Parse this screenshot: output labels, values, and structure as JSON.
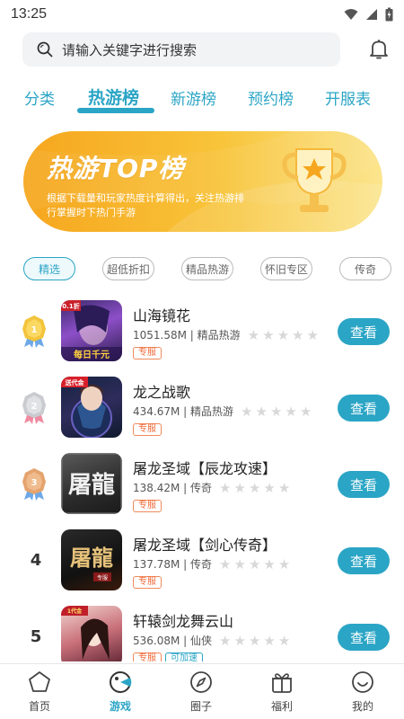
{
  "status": {
    "time": "13:25"
  },
  "search": {
    "placeholder": "请输入关键字进行搜索"
  },
  "tabs": [
    {
      "label": "分类",
      "active": false
    },
    {
      "label": "热游榜",
      "active": true
    },
    {
      "label": "新游榜",
      "active": false
    },
    {
      "label": "预约榜",
      "active": false
    },
    {
      "label": "开服表",
      "active": false
    }
  ],
  "banner": {
    "title": "热游TOP榜",
    "description": "根据下载量和玩家热度计算得出，关注热游排行掌握时下热门手游"
  },
  "filters": [
    {
      "label": "精选",
      "active": true
    },
    {
      "label": "超低折扣",
      "active": false
    },
    {
      "label": "精品热游",
      "active": false
    },
    {
      "label": "怀旧专区",
      "active": false
    },
    {
      "label": "传奇",
      "active": false
    }
  ],
  "games": [
    {
      "rank": "1",
      "name": "山海镜花",
      "size": "1051.58M",
      "category": "精品热游",
      "tags": [
        "专服"
      ],
      "rating": 0,
      "action": "查看"
    },
    {
      "rank": "2",
      "name": "龙之战歌",
      "size": "434.67M",
      "category": "精品热游",
      "tags": [
        "专服"
      ],
      "rating": 0,
      "action": "查看"
    },
    {
      "rank": "3",
      "name": "屠龙圣域【辰龙攻速】",
      "size": "138.42M",
      "category": "传奇",
      "tags": [
        "专服"
      ],
      "rating": 0,
      "action": "查看"
    },
    {
      "rank": "4",
      "name": "屠龙圣域【剑心传奇】",
      "size": "137.78M",
      "category": "传奇",
      "tags": [
        "专服"
      ],
      "rating": 0,
      "action": "查看"
    },
    {
      "rank": "5",
      "name": "轩辕剑龙舞云山",
      "size": "536.08M",
      "category": "仙侠",
      "tags": [
        "专服",
        "可加速"
      ],
      "rating": 0,
      "action": "查看"
    }
  ],
  "icon_texts": {
    "g1_top": "0.1折",
    "g1_bottom": "每日千元",
    "g2_top": "送代金",
    "g3_art": "屠龍",
    "g4_art": "屠龍",
    "g4_sub": "专服",
    "g5_top": "1代金"
  },
  "nav": [
    {
      "label": "首页",
      "icon": "home-pentagon-icon",
      "active": false
    },
    {
      "label": "游戏",
      "icon": "game-icon",
      "active": true
    },
    {
      "label": "圈子",
      "icon": "compass-icon",
      "active": false
    },
    {
      "label": "福利",
      "icon": "gift-icon",
      "active": false
    },
    {
      "label": "我的",
      "icon": "smile-face-icon",
      "active": false
    }
  ],
  "colors": {
    "accent": "#2ba5c5",
    "banner_start": "#f6a61e",
    "banner_end": "#fbe58d",
    "tag_orange": "#f06a3a"
  }
}
